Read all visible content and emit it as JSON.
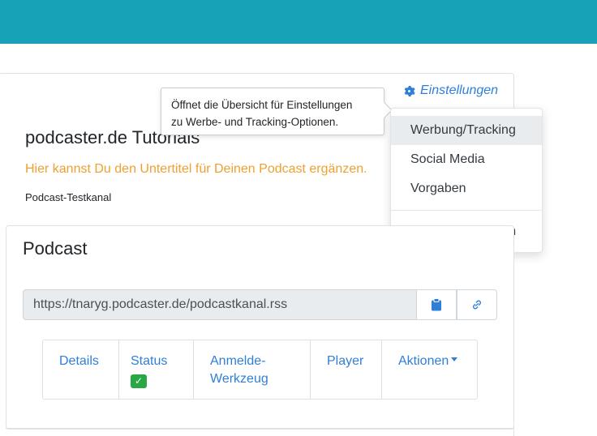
{
  "header": {
    "bar_color": "#17a2b8"
  },
  "settings": {
    "label": "Einstellungen",
    "icon": "gear-icon",
    "color": "#2f7fd8"
  },
  "tooltip": {
    "line1": "Öffnet die Übersicht für Einstellungen",
    "line2": "zu Werbe- und Tracking-Optionen."
  },
  "dropdown": {
    "items": [
      {
        "label": "Werbung/Tracking"
      },
      {
        "label": "Social Media"
      },
      {
        "label": "Vorgaben"
      },
      {
        "label": "Basis-URL ändern"
      }
    ]
  },
  "channel": {
    "title": "podcaster.de Tutorials",
    "subtitle": "Hier kannst Du den Untertitel für Deinen Podcast ergänzen.",
    "subtitle_color": "#f0a030",
    "name": "Podcast-Testkanal"
  },
  "podcast": {
    "heading": "Podcast",
    "feed_url": "https://tnaryg.podcaster.de/podcastkanal.rss",
    "copy_icon": "clipboard-icon",
    "link_icon": "link-icon"
  },
  "tabs": {
    "details": "Details",
    "status": "Status",
    "status_badge": "✓",
    "anmelde_line1": "Anmelde-",
    "anmelde_line2": "Werkzeug",
    "player": "Player",
    "aktionen": "Aktionen"
  }
}
